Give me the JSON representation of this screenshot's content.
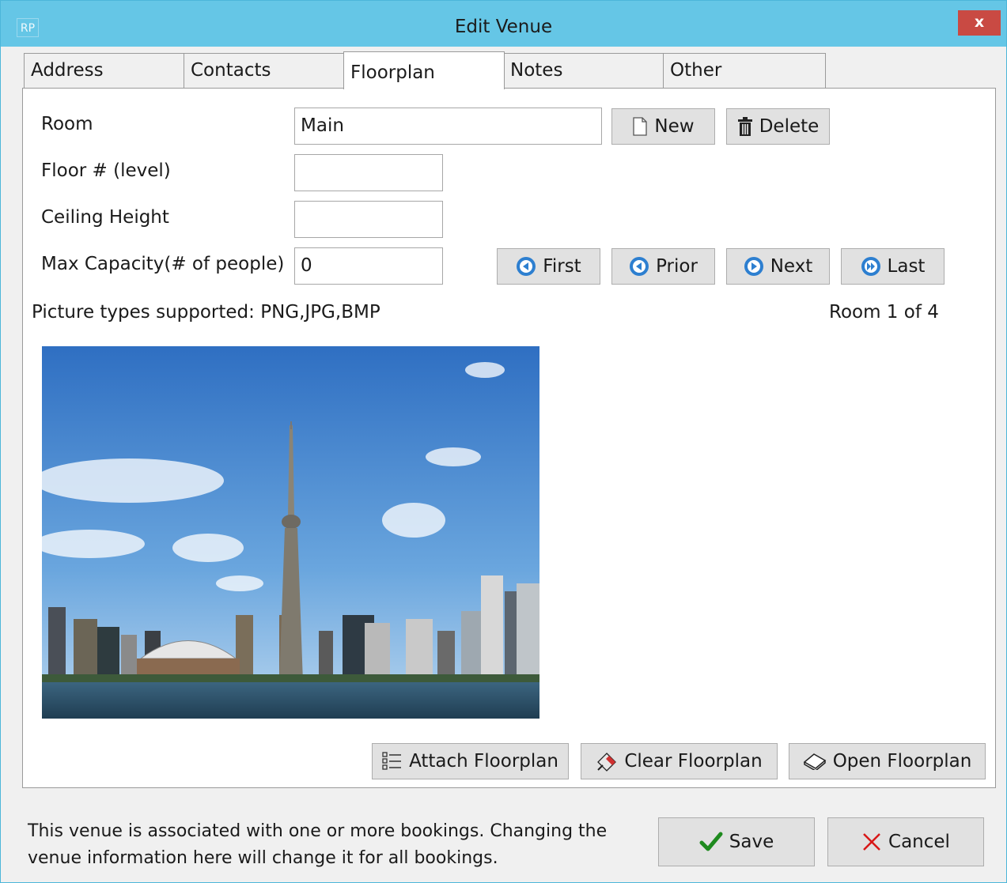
{
  "window": {
    "app_icon": "RP",
    "title": "Edit Venue",
    "close_label": "x"
  },
  "tabs": [
    {
      "label": "Address"
    },
    {
      "label": "Contacts"
    },
    {
      "label": "Floorplan",
      "active": true
    },
    {
      "label": "Notes"
    },
    {
      "label": "Other"
    }
  ],
  "form": {
    "room": {
      "label": "Room",
      "value": "Main"
    },
    "floor": {
      "label": "Floor # (level)",
      "value": ""
    },
    "ceiling": {
      "label": "Ceiling Height",
      "value": ""
    },
    "capacity": {
      "label": "Max Capacity(# of people)",
      "value": "0"
    }
  },
  "buttons": {
    "new": "New",
    "delete": "Delete",
    "first": "First",
    "prior": "Prior",
    "next": "Next",
    "last": "Last",
    "attach": "Attach Floorplan",
    "clear": "Clear Floorplan",
    "open": "Open Floorplan",
    "save": "Save",
    "cancel": "Cancel"
  },
  "info": {
    "picture_types": "Picture types supported: PNG,JPG,BMP",
    "room_counter": "Room 1 of 4"
  },
  "footer": {
    "message_line1": "This venue is associated with one or more bookings.  Changing the",
    "message_line2": "venue information here will change it for all bookings."
  },
  "colors": {
    "titlebar": "#65c6e6",
    "close": "#c94a43",
    "nav_icon": "#2d7fd0",
    "save_check": "#1e8a1e",
    "cancel_x": "#d81818"
  }
}
